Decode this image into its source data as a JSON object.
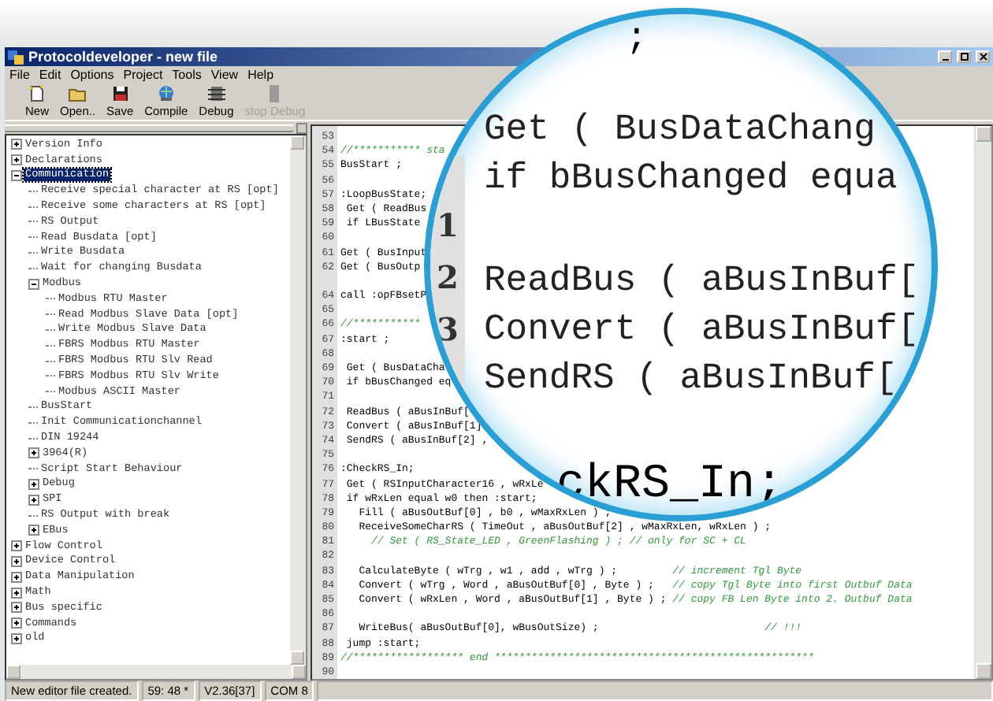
{
  "window": {
    "title": "Protocoldeveloper - new file"
  },
  "menu": [
    "File",
    "Edit",
    "Options",
    "Project",
    "Tools",
    "View",
    "Help"
  ],
  "toolbar": [
    {
      "kind": "new",
      "label": "New",
      "disabled": false
    },
    {
      "kind": "open",
      "label": "Open..",
      "disabled": false
    },
    {
      "kind": "save",
      "label": "Save",
      "disabled": false
    },
    {
      "kind": "compile",
      "label": "Compile",
      "disabled": false
    },
    {
      "kind": "debug",
      "label": "Debug",
      "disabled": false
    },
    {
      "kind": "stop",
      "label": "stop Debug",
      "disabled": true
    }
  ],
  "tree": [
    {
      "label": "Version Info",
      "expanded": false,
      "selected": false
    },
    {
      "label": "Declarations",
      "expanded": false,
      "selected": false
    },
    {
      "label": "Communication",
      "expanded": true,
      "selected": true,
      "children": [
        {
          "label": "Receive special character at RS [opt]",
          "selected": false
        },
        {
          "label": "Receive some characters at RS [opt]",
          "selected": false
        },
        {
          "label": "RS Output",
          "selected": false
        },
        {
          "label": "Read Busdata [opt]",
          "selected": false
        },
        {
          "label": "Write Busdata",
          "selected": false
        },
        {
          "label": "Wait for changing Busdata",
          "selected": false
        },
        {
          "label": "Modbus",
          "expanded": true,
          "selected": false,
          "children": [
            {
              "label": "Modbus RTU Master",
              "selected": false
            },
            {
              "label": "Read Modbus Slave Data [opt]",
              "selected": false
            },
            {
              "label": "Write Modbus Slave Data",
              "selected": false
            },
            {
              "label": "FBRS Modbus RTU Master",
              "selected": false
            },
            {
              "label": "FBRS Modbus RTU Slv Read",
              "selected": false
            },
            {
              "label": "FBRS Modbus RTU Slv Write",
              "selected": false
            },
            {
              "label": "Modbus ASCII Master",
              "selected": false
            }
          ]
        },
        {
          "label": "BusStart",
          "selected": false
        },
        {
          "label": "Init Communicationchannel",
          "selected": false
        },
        {
          "label": "DIN 19244",
          "selected": false
        },
        {
          "label": "3964(R)",
          "expanded": false,
          "selected": false
        },
        {
          "label": "Script Start Behaviour",
          "selected": false
        },
        {
          "label": "Debug",
          "expanded": false,
          "selected": false
        },
        {
          "label": "SPI",
          "expanded": false,
          "selected": false
        },
        {
          "label": "RS Output with break",
          "selected": false
        },
        {
          "label": "EBus",
          "expanded": false,
          "selected": false
        }
      ]
    },
    {
      "label": "Flow Control",
      "expanded": false,
      "selected": false
    },
    {
      "label": "Device Control",
      "expanded": false,
      "selected": false
    },
    {
      "label": "Data Manipulation",
      "expanded": false,
      "selected": false
    },
    {
      "label": "Math",
      "expanded": false,
      "selected": false
    },
    {
      "label": "Bus specific",
      "expanded": false,
      "selected": false
    },
    {
      "label": "Commands",
      "expanded": false,
      "selected": false
    },
    {
      "label": "old",
      "expanded": false,
      "selected": false
    }
  ],
  "editor": {
    "lines": [
      {
        "number": "53"
      },
      {
        "number": "54",
        "comment": "//*********** sta"
      },
      {
        "number": "55",
        "code": "BusStart ;"
      },
      {
        "number": "56"
      },
      {
        "number": "57",
        "code": ":LoopBusState;"
      },
      {
        "number": "58",
        "code": " Get ( ReadBus"
      },
      {
        "number": "59",
        "code": " if LBusState"
      },
      {
        "number": "60"
      },
      {
        "number": "61",
        "code": "Get ( BusInput"
      },
      {
        "number": "62",
        "code": "Get ( BusOutp"
      },
      {
        "number": "64",
        "code": "call :opFBsetP"
      },
      {
        "number": "65"
      },
      {
        "number": "66",
        "comment": "//***********"
      },
      {
        "number": "67",
        "code": ":start ;"
      },
      {
        "number": "68"
      },
      {
        "number": "69",
        "code": " Get ( BusDataCha"
      },
      {
        "number": "70",
        "code": " if bBusChanged eq"
      },
      {
        "number": "71"
      },
      {
        "number": "72",
        "code": " ReadBus ( aBusInBuf["
      },
      {
        "number": "73",
        "code": " Convert ( aBusInBuf[1]"
      },
      {
        "number": "74",
        "code": " SendRS ( aBusInBuf[2] ,"
      },
      {
        "number": "75"
      },
      {
        "number": "76",
        "code": ":CheckRS_In;"
      },
      {
        "number": "77",
        "code": " Get ( RSInputCharacter16 , wRxLe"
      },
      {
        "number": "78",
        "code": " if wRxLen equal w0 then :start;"
      },
      {
        "number": "79",
        "code": "   Fill ( aBusOutBuf[0] , b0 , wMaxRxLen ) ;"
      },
      {
        "number": "80",
        "code": "   ReceiveSomeCharRS ( TimeOut , aBusOutBuf[2] , wMaxRxLen, wRxLen ) ;"
      },
      {
        "number": "81",
        "comment": "     // Set ( RS_State_LED , GreenFlashing ) ; // only for SC + CL"
      },
      {
        "number": "82"
      },
      {
        "number": "83",
        "code": "   CalculateByte ( wTrg , w1 , add , wTrg ) ;         ",
        "comment": "// increment Tgl Byte"
      },
      {
        "number": "84",
        "code": "   Convert ( wTrg , Word , aBusOutBuf[0] , Byte ) ;   ",
        "comment": "// copy Tgl Byte into first Outbuf Data"
      },
      {
        "number": "85",
        "code": "   Convert ( wRxLen , Word , aBusOutBuf[1] , Byte ) ; ",
        "comment": "// copy FB Len Byte into 2. Outbuf Data"
      },
      {
        "number": "86"
      },
      {
        "number": "87",
        "code": "   WriteBus( aBusOutBuf[0], wBusOutSize) ;                           ",
        "comment": "// !!!"
      },
      {
        "number": "88",
        "code": " jump :start;"
      },
      {
        "number": "89",
        "comment": "//****************** end ****************************************************"
      },
      {
        "number": "90"
      }
    ]
  },
  "magnifier": {
    "top_text": ";",
    "upper_lines": [
      "Get ( BusDataChang",
      "if bBusChanged equa"
    ],
    "lower_lines": [
      "ReadBus ( aBusInBuf[",
      "Convert ( aBusInBuf[",
      "SendRS ( aBusInBuf["
    ],
    "gutter_numbers": [
      "1",
      "2",
      "3"
    ],
    "bottom_text": "ckRS_In;"
  },
  "status_bar": [
    "New editor file created.",
    "59: 48 *",
    "V2.36[37]",
    "COM 8"
  ]
}
